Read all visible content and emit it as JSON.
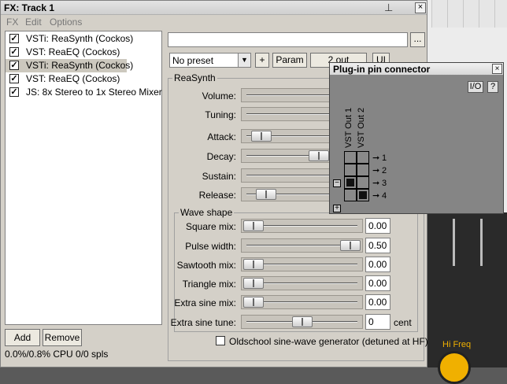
{
  "window": {
    "title": "FX: Track 1",
    "close": "×",
    "pin": "⊥"
  },
  "menu": [
    "FX",
    "Edit",
    "Options"
  ],
  "fx_list": [
    {
      "label": "VSTi: ReaSynth (Cockos)",
      "checked": true
    },
    {
      "label": "VST: ReaEQ (Cockos)",
      "checked": true
    },
    {
      "label": "VSTi: ReaSynth (Cockos)",
      "checked": true,
      "selected": true
    },
    {
      "label": "VST: ReaEQ (Cockos)",
      "checked": true
    },
    {
      "label": "JS: 8x Stereo to 1x Stereo Mixer",
      "checked": true
    }
  ],
  "buttons": {
    "add": "Add",
    "remove": "Remove",
    "browse": "...",
    "plus": "+",
    "param": "Param",
    "out": "2 out",
    "ui": "UI"
  },
  "status": "0.0%/0.8% CPU 0/0 spls",
  "preset": {
    "value": "No preset"
  },
  "synth": {
    "group_title": "ReaSynth",
    "params": [
      {
        "label": "Volume:",
        "pos": 0.72
      },
      {
        "label": "Tuning:",
        "pos": 0.65
      },
      {
        "label": "Attack:",
        "pos": 0.05
      },
      {
        "label": "Decay:",
        "pos": 0.42
      },
      {
        "label": "Sustain:",
        "pos": 0.85
      },
      {
        "label": "Release:",
        "pos": 0.08
      }
    ]
  },
  "wave": {
    "group_title": "Wave shape",
    "params": [
      {
        "label": "Square mix:",
        "pos": 0.0,
        "value": "0.00"
      },
      {
        "label": "Pulse width:",
        "pos": 1.0,
        "value": "0.50"
      },
      {
        "label": "Sawtooth mix:",
        "pos": 0.0,
        "value": "0.00"
      },
      {
        "label": "Triangle mix:",
        "pos": 0.0,
        "value": "0.00"
      },
      {
        "label": "Extra sine mix:",
        "pos": 0.0,
        "value": "0.00"
      },
      {
        "label": "Extra sine tune:",
        "pos": 0.5,
        "value": "0",
        "unit": "cent"
      }
    ],
    "oldschool": "Oldschool sine-wave generator (detuned at HF)"
  },
  "pin": {
    "title": "Plug-in pin connector",
    "io_btn": "I/O",
    "help_btn": "?",
    "col_labels": [
      "VST Out 1",
      "VST Out 2"
    ],
    "rows": [
      "1",
      "2",
      "3",
      "4"
    ],
    "grid": [
      [
        false,
        false
      ],
      [
        false,
        false
      ],
      [
        true,
        false
      ],
      [
        false,
        true
      ]
    ],
    "minus": "−",
    "plus": "+"
  },
  "daw": {
    "hi_freq": "Hi Freq"
  }
}
